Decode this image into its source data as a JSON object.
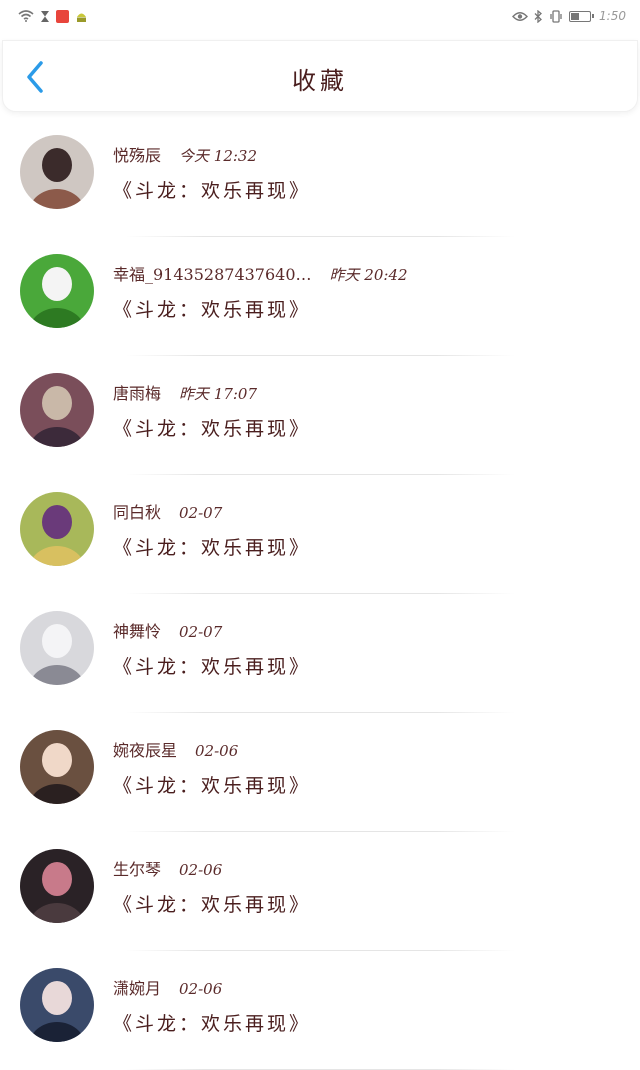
{
  "status_bar": {
    "time": "1:50",
    "battery_level": 0.45,
    "icons": [
      "wifi-icon",
      "hourglass-icon",
      "app-notification-icon",
      "android-icon",
      "eye-icon",
      "bluetooth-icon",
      "vibrate-icon",
      "battery-icon"
    ]
  },
  "header": {
    "title": "收藏",
    "back_icon": "chevron-left-icon",
    "accent": "#2b9be8"
  },
  "favorites": [
    {
      "name": "悦殇辰",
      "time": "今天 12:32",
      "title": "《斗龙：欢乐再现》",
      "avatar_colors": [
        "#cfc7c2",
        "#3b2b2b",
        "#8c5a4a"
      ]
    },
    {
      "name": "幸福_91435287437640…",
      "time": "昨天 20:42",
      "title": "《斗龙：欢乐再现》",
      "avatar_colors": [
        "#4aa83a",
        "#f4f4f4",
        "#2d7a22"
      ]
    },
    {
      "name": "唐雨梅",
      "time": "昨天 17:07",
      "title": "《斗龙：欢乐再现》",
      "avatar_colors": [
        "#7a4e5a",
        "#c9b8a8",
        "#3c2a3a"
      ]
    },
    {
      "name": "同白秋",
      "time": "02-07",
      "title": "《斗龙：欢乐再现》",
      "avatar_colors": [
        "#a8b85a",
        "#6a3a7a",
        "#d8c060"
      ]
    },
    {
      "name": "神舞怜",
      "time": "02-07",
      "title": "《斗龙：欢乐再现》",
      "avatar_colors": [
        "#d8d8dc",
        "#f4f4f6",
        "#8a8a94"
      ]
    },
    {
      "name": "婉夜辰星",
      "time": "02-06",
      "title": "《斗龙：欢乐再现》",
      "avatar_colors": [
        "#6a5040",
        "#f0d8c8",
        "#2a2020"
      ]
    },
    {
      "name": "生尔琴",
      "time": "02-06",
      "title": "《斗龙：欢乐再现》",
      "avatar_colors": [
        "#2a2226",
        "#c87a8a",
        "#4a3a3e"
      ]
    },
    {
      "name": "潇婉月",
      "time": "02-06",
      "title": "《斗龙：欢乐再现》",
      "avatar_colors": [
        "#3a4a6a",
        "#e8d8d8",
        "#1a2236"
      ]
    }
  ]
}
